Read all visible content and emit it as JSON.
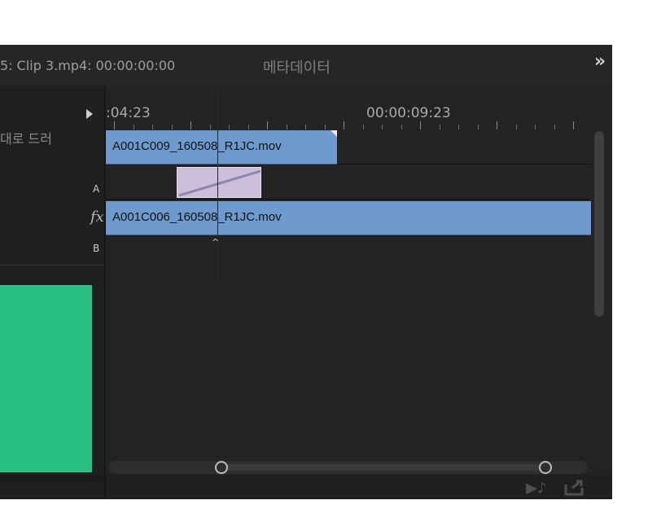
{
  "header": {
    "active_tab": "5: Clip 3.mp4: 00:00:00:00",
    "metadata_tab": "메타데이터",
    "overflow_icon": "»"
  },
  "left_panel": {
    "drag_hint": "대로 드러",
    "track_a_label": "A",
    "fx_label": "fx",
    "track_b_label": "B",
    "swatch_color": "#27c185"
  },
  "timeline": {
    "timecode_left": ":04:23",
    "timecode_right": "00:00:09:23",
    "clip_a_name": "A001C009_160508_R1JC.mov",
    "clip_b_name": "A001C006_160508_R1JC.mov",
    "clip_color": "#6e9acd",
    "transition_color": "#cdbfdc",
    "playhead_caret": "^"
  },
  "footer": {
    "audio_icon": "▶♪",
    "export_icon": "export-icon"
  }
}
